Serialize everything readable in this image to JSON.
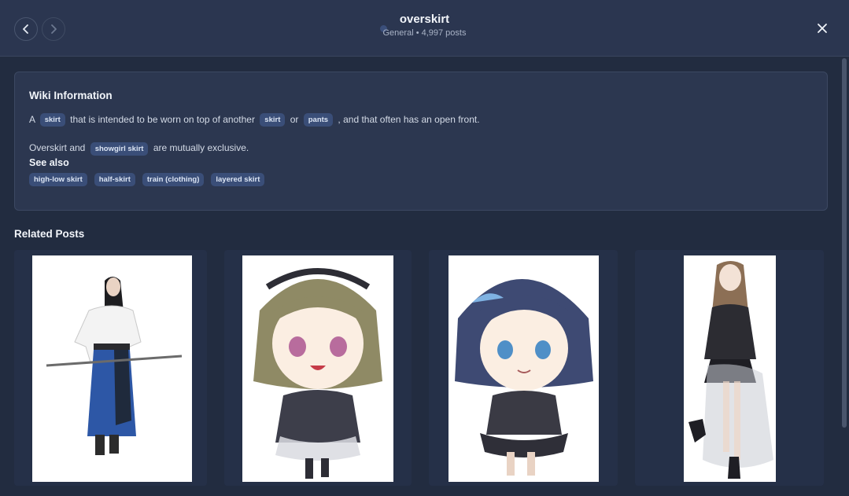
{
  "header": {
    "title": "overskirt",
    "subtitle": "General • 4,997 posts"
  },
  "wiki": {
    "heading": "Wiki Information",
    "line1": {
      "w1": "A",
      "c1": "skirt",
      "w2": "that is intended to be worn on top of another",
      "c2": "skirt",
      "w3": "or",
      "c3": "pants",
      "w4": ", and that often has an open front."
    },
    "line2": {
      "w1": "Overskirt and",
      "c1": "showgirl skirt",
      "w2": "are mutually exclusive."
    },
    "see_also_label": "See also",
    "see_also": [
      "high-low skirt",
      "half-skirt",
      "train (clothing)",
      "layered skirt"
    ]
  },
  "related": {
    "heading": "Related Posts"
  },
  "colors": {
    "background": "#222c40",
    "header": "#2b3650",
    "panel": "#2c3750",
    "chip": "#3a4e78"
  },
  "icons": [
    "chevron-left-icon",
    "chevron-right-icon",
    "close-icon"
  ]
}
